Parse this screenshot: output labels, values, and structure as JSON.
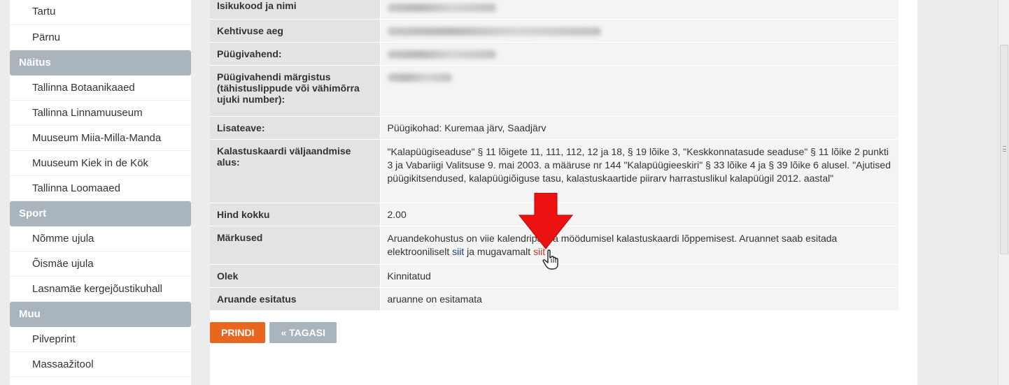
{
  "sidebar": {
    "items_top": [
      "Tartu",
      "Pärnu"
    ],
    "groups": [
      {
        "title": "Näitus",
        "items": [
          "Tallinna Botaanikaaed",
          "Tallinna Linnamuuseum",
          "Muuseum Miia-Milla-Manda",
          "Muuseum Kiek in de Kök",
          "Tallinna Loomaaed"
        ]
      },
      {
        "title": "Sport",
        "items": [
          "Nõmme ujula",
          "Õismäe ujula",
          "Lasnamäe kergejõustikuhall"
        ]
      },
      {
        "title": "Muu",
        "items": [
          "Pilveprint",
          "Massaažitool"
        ]
      }
    ]
  },
  "details": {
    "rows": [
      {
        "label": "Isikukood ja nimi"
      },
      {
        "label": "Kehtivuse aeg"
      },
      {
        "label": "Püügivahend:"
      },
      {
        "label": "Püügivahendi märgistus (tähistuslippude või vähimõrra ujuki number):"
      },
      {
        "label": "Lisateave:",
        "value": "Püügikohad: Kuremaa järv, Saadjärv"
      },
      {
        "label": "Kalastuskaardi väljaandmise alus:",
        "value": "\"Kalapüügiseaduse\" § 11 lõigete 11, 111, 112, 12 ja 18, § 19 lõike 3, \"Keskkonnatasude seaduse\" § 11 lõike 2 punkti 3 ja Vabariigi Valitsuse 9. mai 2003. a määruse nr 144 \"Kalapüügieeskiri\" § 33 lõike 4 ja § 39 lõike 6 alusel. \"Ajutised püügikitsendused, kalapüügiõiguse tasu, kalastuskaartide piirarv harrastuslikul kalapüügil 2012. aastal\""
      },
      {
        "label": "Hind kokku",
        "value": "2.00"
      },
      {
        "label": "Märkused",
        "value_part1": "Aruandekohustus on viie kalendripäeva möödumisel kalastuskaardi lõppemisest. Aruannet saab esitada elektrooniliselt ",
        "link1": "siit",
        "value_part2": " ja mugavamalt ",
        "link2": "siit"
      },
      {
        "label": "Olek",
        "value": "Kinnitatud"
      },
      {
        "label": "Aruande esitatus",
        "value": "aruanne on esitamata"
      }
    ]
  },
  "buttons": {
    "print": "PRINDI",
    "back": "« TAGASI"
  },
  "colors": {
    "accent_orange": "#e8661d",
    "sidebar_header": "#a9b4bd",
    "arrow_red": "#ee1111"
  }
}
